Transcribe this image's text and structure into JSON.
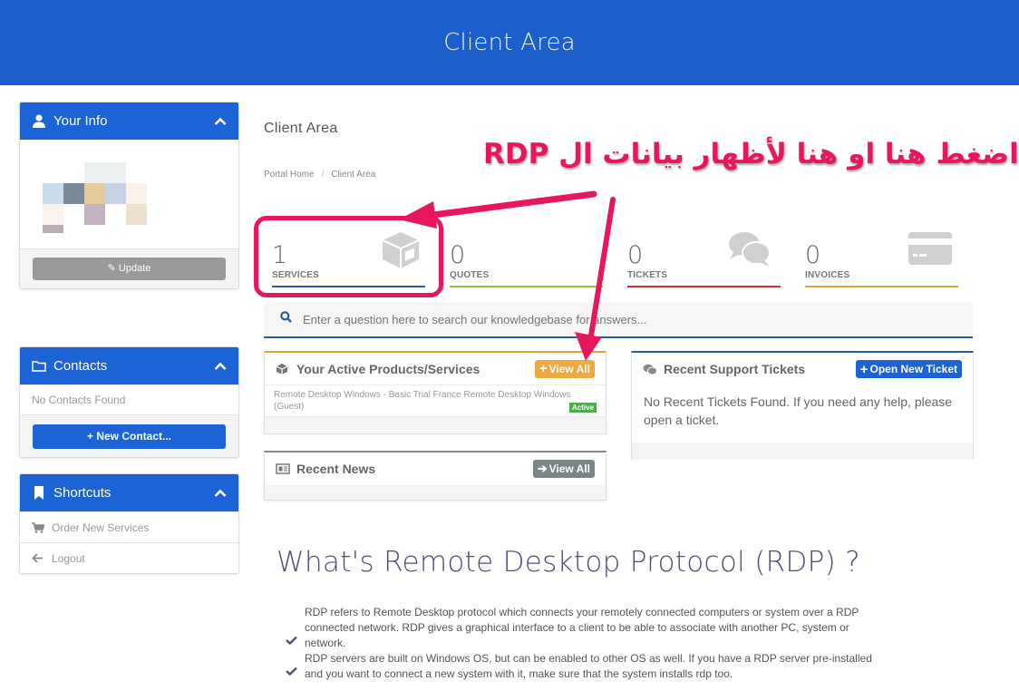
{
  "header": {
    "title": "Client Area"
  },
  "sidebar": {
    "your_info": {
      "title": "Your Info",
      "update_label": "Update"
    },
    "contacts": {
      "title": "Contacts",
      "empty_text": "No Contacts Found",
      "new_contact_label": "New Contact..."
    },
    "shortcuts": {
      "title": "Shortcuts",
      "items": [
        {
          "label": "Order New Services",
          "icon": "cart-icon"
        },
        {
          "label": "Logout",
          "icon": "arrow-left-icon"
        }
      ]
    }
  },
  "main": {
    "page_title": "Client Area",
    "breadcrumb": [
      {
        "label": "Portal Home"
      },
      {
        "label": "Client Area"
      }
    ],
    "stats": [
      {
        "value": "1",
        "label": "SERVICES",
        "color": "#2b5aa0",
        "icon": "cube-icon"
      },
      {
        "value": "0",
        "label": "QUOTES",
        "color": "#8cc63f",
        "icon": ""
      },
      {
        "value": "0",
        "label": "TICKETS",
        "color": "#c0392b",
        "icon": "comments-icon"
      },
      {
        "value": "0",
        "label": "INVOICES",
        "color": "#e0a53a",
        "icon": "credit-card-icon"
      }
    ],
    "search": {
      "placeholder": "Enter a question here to search our knowledgebase for answers..."
    },
    "products": {
      "title": "Your Active Products/Services",
      "view_all_label": "View All",
      "items": [
        {
          "name": "Remote Desktop Windows - Basic Trial France Remote Desktop Windows (Guest)",
          "status": "Active"
        }
      ]
    },
    "tickets": {
      "title": "Recent Support Tickets",
      "open_new_label": "Open New Ticket",
      "empty_text": "No Recent Tickets Found. If you need any help, please open a ticket."
    },
    "news": {
      "title": "Recent News",
      "view_all_label": "View All"
    },
    "rdp": {
      "title": "What's Remote Desktop Protocol (RDP) ?",
      "features": [
        "RDP refers to Remote Desktop protocol which connects your remotely connected computers or system over a RDP connected network. RDP gives a graphical interface to a client to be able to associate with another PC, system or network.",
        "RDP servers are built on Windows OS, but can be enabled to other OS as well. If you have a RDP server pre-installed and you want to connect a new system with it, make sure that the system installs rdp too."
      ]
    }
  },
  "annotation": {
    "text": "اضغط هنا او هنا لأظهار بيانات ال RDP",
    "color": "#e8175d"
  },
  "colors": {
    "header_bg": "#1c5ecb",
    "panel_head": "#1c63d6",
    "orange_button": "#f0a940",
    "gray_button": "#7a8585",
    "active_badge": "#4cae4c"
  }
}
